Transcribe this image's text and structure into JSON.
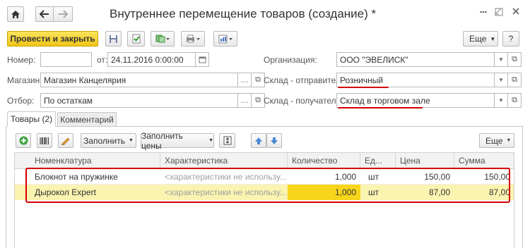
{
  "window": {
    "title": "Внутреннее перемещение товаров (создание) *",
    "home_icon": "home-icon",
    "back_icon": "arrow-left-icon",
    "forward_icon": "arrow-right-icon",
    "star_icon": "star-icon",
    "menu_icon": "kebab-menu-icon",
    "close_icon": "close-icon"
  },
  "toolbar": {
    "post_close_label": "Провести и закрыть",
    "more_label": "Еще",
    "help_label": "?"
  },
  "form": {
    "number_label": "Номер:",
    "number_value": "",
    "from_label": "от:",
    "date_value": "24.11.2016  0:00:00",
    "organization_label": "Организация:",
    "organization_value": "ООО \"ЭВЕЛИСК\"",
    "store_label": "Магазин:",
    "store_value": "Магазин Канцелярия",
    "sender_label": "Склад - отправитель:",
    "sender_value": "Розничный",
    "filter_label": "Отбор:",
    "filter_value": "По остаткам",
    "receiver_label": "Склад - получатель:",
    "receiver_value": "Склад в торговом зале"
  },
  "tabs": [
    {
      "label": "Товары (2)",
      "active": true
    },
    {
      "label": "Комментарий",
      "active": false
    }
  ],
  "table_toolbar": {
    "fill_label": "Заполнить",
    "fill_prices_label": "Заполнить цены",
    "more_label": "Еще"
  },
  "table": {
    "columns": [
      "Номенклатура",
      "Характеристика",
      "Количество",
      "Ед...",
      "Цена",
      "Сумма"
    ],
    "rows": [
      {
        "item": "Блокнот на пружинке",
        "characteristic": "<характеристики не использу...",
        "qty": "1,000",
        "unit": "шт",
        "price": "150,00",
        "sum": "150,00"
      },
      {
        "item": "Дырокол Expert",
        "characteristic": "<характеристики не использу...",
        "qty": "1,000",
        "unit": "шт",
        "price": "87,00",
        "sum": "87,00"
      }
    ]
  },
  "colors": {
    "highlight_red": "#d40000",
    "selected_row": "#fbf3b0",
    "selected_cell": "#f7d51b",
    "primary_button": "#f4cd1f"
  }
}
